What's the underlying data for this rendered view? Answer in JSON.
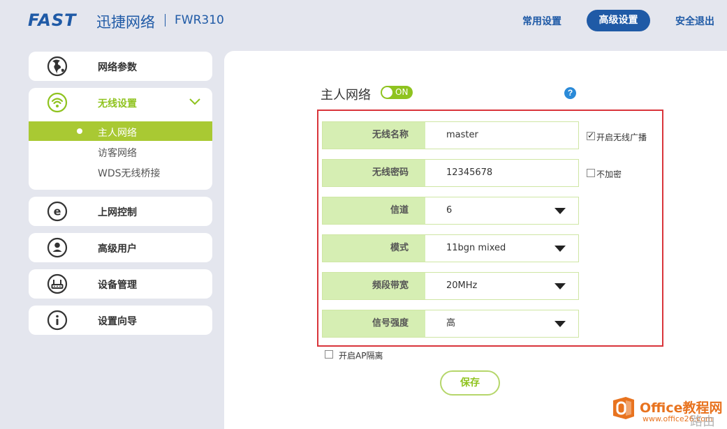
{
  "header": {
    "logo": "FAST",
    "brand_cn": "迅捷网络",
    "model": "FWR310",
    "nav": {
      "common": "常用设置",
      "advanced": "高级设置",
      "logout": "安全退出"
    }
  },
  "sidebar": {
    "items": [
      {
        "label": "网络参数",
        "icon": "globe-icon"
      },
      {
        "label": "无线设置",
        "icon": "wifi-icon",
        "expanded": true,
        "subitems": [
          {
            "label": "主人网络",
            "active": true
          },
          {
            "label": "访客网络",
            "active": false
          },
          {
            "label": "WDS无线桥接",
            "active": false
          }
        ]
      },
      {
        "label": "上网控制",
        "icon": "internet-e-icon"
      },
      {
        "label": "高级用户",
        "icon": "user-icon"
      },
      {
        "label": "设备管理",
        "icon": "router-icon"
      },
      {
        "label": "设置向导",
        "icon": "info-icon"
      }
    ]
  },
  "main": {
    "title": "主人网络",
    "toggle": "ON",
    "help": "?",
    "fields": [
      {
        "label": "无线名称",
        "value": "master",
        "type": "input"
      },
      {
        "label": "无线密码",
        "value": "12345678",
        "type": "input"
      },
      {
        "label": "信道",
        "value": "6",
        "type": "select"
      },
      {
        "label": "模式",
        "value": "11bgn mixed",
        "type": "select"
      },
      {
        "label": "频段带宽",
        "value": "20MHz",
        "type": "select"
      },
      {
        "label": "信号强度",
        "value": "高",
        "type": "select"
      }
    ],
    "broadcast_label": "开启无线广播",
    "broadcast_checked": true,
    "no_encrypt_label": "不加密",
    "no_encrypt_checked": false,
    "ap_isolation_label": "开启AP隔离",
    "ap_isolation_checked": false,
    "save_label": "保存"
  },
  "watermark": {
    "text": "Office教程网",
    "url": "www.office26.com",
    "extra": "路由网"
  },
  "colors": {
    "brand_blue": "#1f5aa6",
    "accent_green": "#8fc31f",
    "active_green": "#a9c933",
    "label_bg": "#d6eeb3",
    "highlight_red": "#d9343a"
  }
}
